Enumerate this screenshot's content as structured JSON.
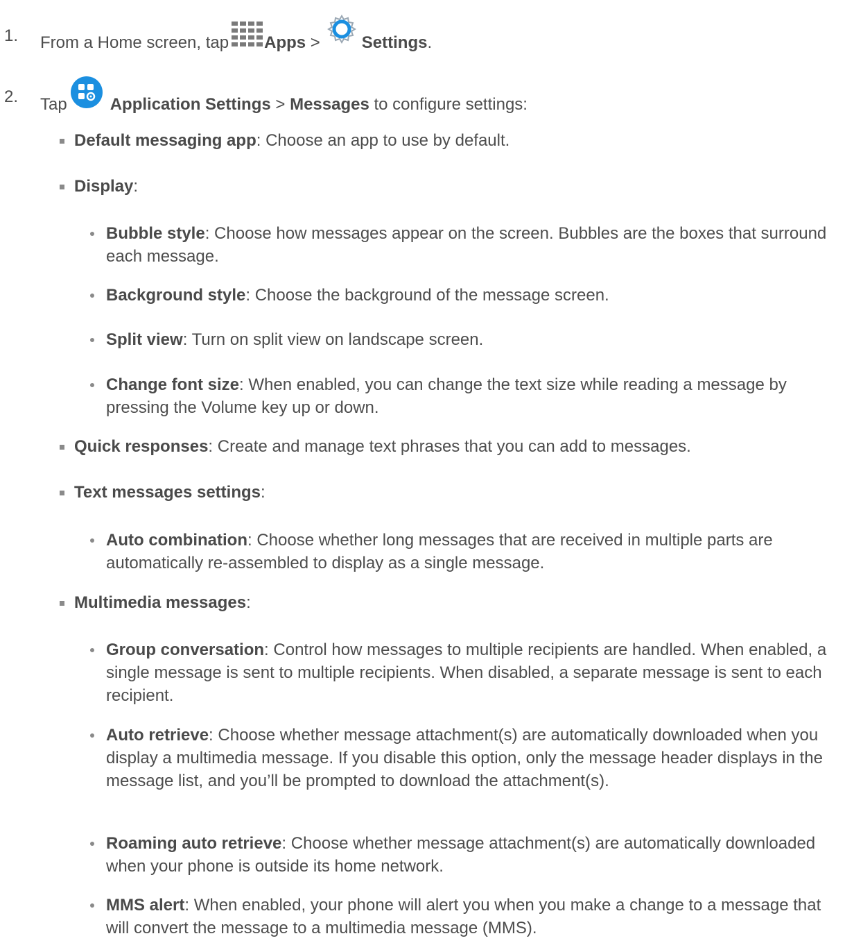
{
  "step1": {
    "num": "1.",
    "pre": "From a Home screen, tap",
    "apps_label": "Apps",
    "sep": ">",
    "settings_label": "Settings",
    "end": "."
  },
  "step2": {
    "num": "2.",
    "pre": "Tap",
    "app_settings_label": "Application Settings",
    "sep": ">",
    "messages_label": "Messages",
    "post": "to configure settings:"
  },
  "items": {
    "default_app": {
      "term": "Default messaging app",
      "desc": ": Choose an app to use by default."
    },
    "display": {
      "term": "Display",
      "desc": ":"
    },
    "bubble_style": {
      "term": "Bubble style",
      "desc": ": Choose how messages appear on the screen. Bubbles are the boxes that surround each message."
    },
    "background_style": {
      "term": "Background style",
      "desc": ": Choose the background of the message screen."
    },
    "split_view": {
      "term": "Split view",
      "desc": ": Turn on split view on landscape screen."
    },
    "change_font_size": {
      "term": "Change font size",
      "desc": ": When enabled, you can change the text size while reading a message by pressing the Volume key up or down."
    },
    "quick_responses": {
      "term": "Quick responses",
      "desc": ": Create and manage text phrases that you can add to messages."
    },
    "text_settings": {
      "term": "Text messages settings",
      "desc": ":"
    },
    "auto_combination": {
      "term": "Auto combination",
      "desc": ": Choose whether long messages that are received in multiple parts are automatically re-assembled to display as a single message."
    },
    "multimedia": {
      "term": "Multimedia messages",
      "desc": ":"
    },
    "group_conversation": {
      "term": "Group conversation",
      "desc": ": Control how messages to multiple recipients are handled. When enabled, a single message is sent to multiple recipients. When disabled, a separate message is sent to each recipient."
    },
    "auto_retrieve": {
      "term": "Auto retrieve",
      "desc": ": Choose whether message attachment(s) are automatically downloaded when you display a multimedia message. If you disable this option, only the message header displays in the message list, and you’ll be prompted to download the attachment(s)."
    },
    "roaming_auto_retrieve": {
      "term": "Roaming auto retrieve",
      "desc": ": Choose whether message attachment(s) are automatically downloaded when your phone is outside its home network."
    },
    "mms_alert": {
      "term": "MMS alert",
      "desc": ": When enabled, your phone will alert you when you make a change to a message that will convert the message to a multimedia message (MMS)."
    }
  },
  "icons": {
    "apps": "apps-grid-icon",
    "settings": "settings-gear-icon",
    "application_settings": "application-settings-icon"
  },
  "colors": {
    "text": "#4d4d4d",
    "icon_blue": "#1b8fe0",
    "bullet": "#8a8a8a"
  }
}
